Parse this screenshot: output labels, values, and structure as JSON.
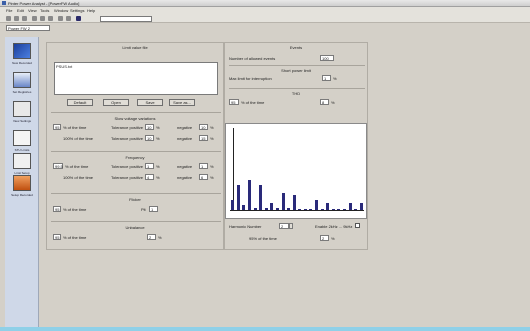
{
  "window": {
    "title": "Pinter Power Analyst - [PowerFW Audio]"
  },
  "menu": [
    "File",
    "Edit",
    "View",
    "Tools",
    "Window",
    "Settings",
    "Help"
  ],
  "document_selector": "Power FW 2",
  "sidebar": [
    {
      "label": "New Recorded",
      "icon": "monitor-icon"
    },
    {
      "label": "Set Registries",
      "icon": "chart-icon"
    },
    {
      "label": "View Settings",
      "icon": "settings-icon"
    },
    {
      "label": "STU Limits",
      "icon": "wave-icon"
    },
    {
      "label": "Limit Setup",
      "icon": "tool-icon"
    },
    {
      "label": "Setup Recorded",
      "icon": "recorder-icon"
    }
  ],
  "limit_file": {
    "title": "Limit value file",
    "file_value": "PSUS.txt",
    "buttons": [
      "Default",
      "Open",
      "Save",
      "Save as..."
    ]
  },
  "slow_voltage": {
    "title": "Slow voltage variations",
    "row1": {
      "value": "95",
      "label": "% of the time",
      "pos_label": "Tolerance positive",
      "pos_value": "10",
      "pos_unit": "%",
      "neg_label": "negative",
      "neg_value": "10",
      "neg_unit": "%"
    },
    "row2": {
      "label": "100% of the time",
      "pos_label": "Tolerance positive",
      "pos_value": "10",
      "pos_unit": "%",
      "neg_label": "negative",
      "neg_value": "15",
      "neg_unit": "%"
    }
  },
  "frequency": {
    "title": "Frequency",
    "row1": {
      "value": "99.5",
      "label": "% of the time",
      "pos_label": "Tolerance positive",
      "pos_value": "1",
      "pos_unit": "%",
      "neg_label": "negative",
      "neg_value": "1",
      "neg_unit": "%"
    },
    "row2": {
      "label": "100% of the time",
      "pos_label": "Tolerance positive",
      "pos_value": "4",
      "pos_unit": "%",
      "neg_label": "negative",
      "neg_value": "6",
      "neg_unit": "%"
    }
  },
  "flicker": {
    "title": "Flicker",
    "value": "95",
    "label": "% of the time",
    "plt_label": "Plt",
    "plt_value": "1"
  },
  "unbalance": {
    "title": "Unbalance",
    "value": "95",
    "label": "% of the time",
    "limit_value": "2",
    "limit_unit": "%"
  },
  "events": {
    "title": "Events",
    "count_label": "Number of allowed events",
    "count_value": "100",
    "short_title": "Short power limit",
    "short_label": "Max limit for interruption",
    "short_value": "1",
    "short_unit": "%"
  },
  "thd": {
    "title": "THD",
    "value": "95",
    "label": "% of the time",
    "limit_value": "8",
    "limit_unit": "%"
  },
  "harmonics": {
    "number_label": "Harmonic Number",
    "number_value": "2",
    "enable_label": "Enable 2kHz ... 9kHz",
    "percent_label": "95% of the time",
    "percent_value": "2",
    "percent_unit": "%"
  },
  "chart_data": {
    "type": "bar",
    "categories": [
      "2",
      "3",
      "4",
      "5",
      "6",
      "7",
      "8",
      "9",
      "10",
      "11",
      "12",
      "13",
      "14",
      "15",
      "16",
      "17",
      "18",
      "19",
      "20",
      "21",
      "22",
      "23",
      "24",
      "25"
    ],
    "values": [
      2,
      5,
      1,
      6,
      0.5,
      5,
      0.5,
      1.5,
      0.5,
      3.5,
      0.5,
      3,
      0.3,
      0.3,
      0.3,
      2,
      0.3,
      1.5,
      0.3,
      0.3,
      0.3,
      1.5,
      0.3,
      1.5
    ],
    "marker_category": "2",
    "marker_value": 100,
    "ylim": [
      0,
      100
    ]
  },
  "colors": {
    "status_bar": "#8fd0e8",
    "bar": "#2a2a7a"
  }
}
